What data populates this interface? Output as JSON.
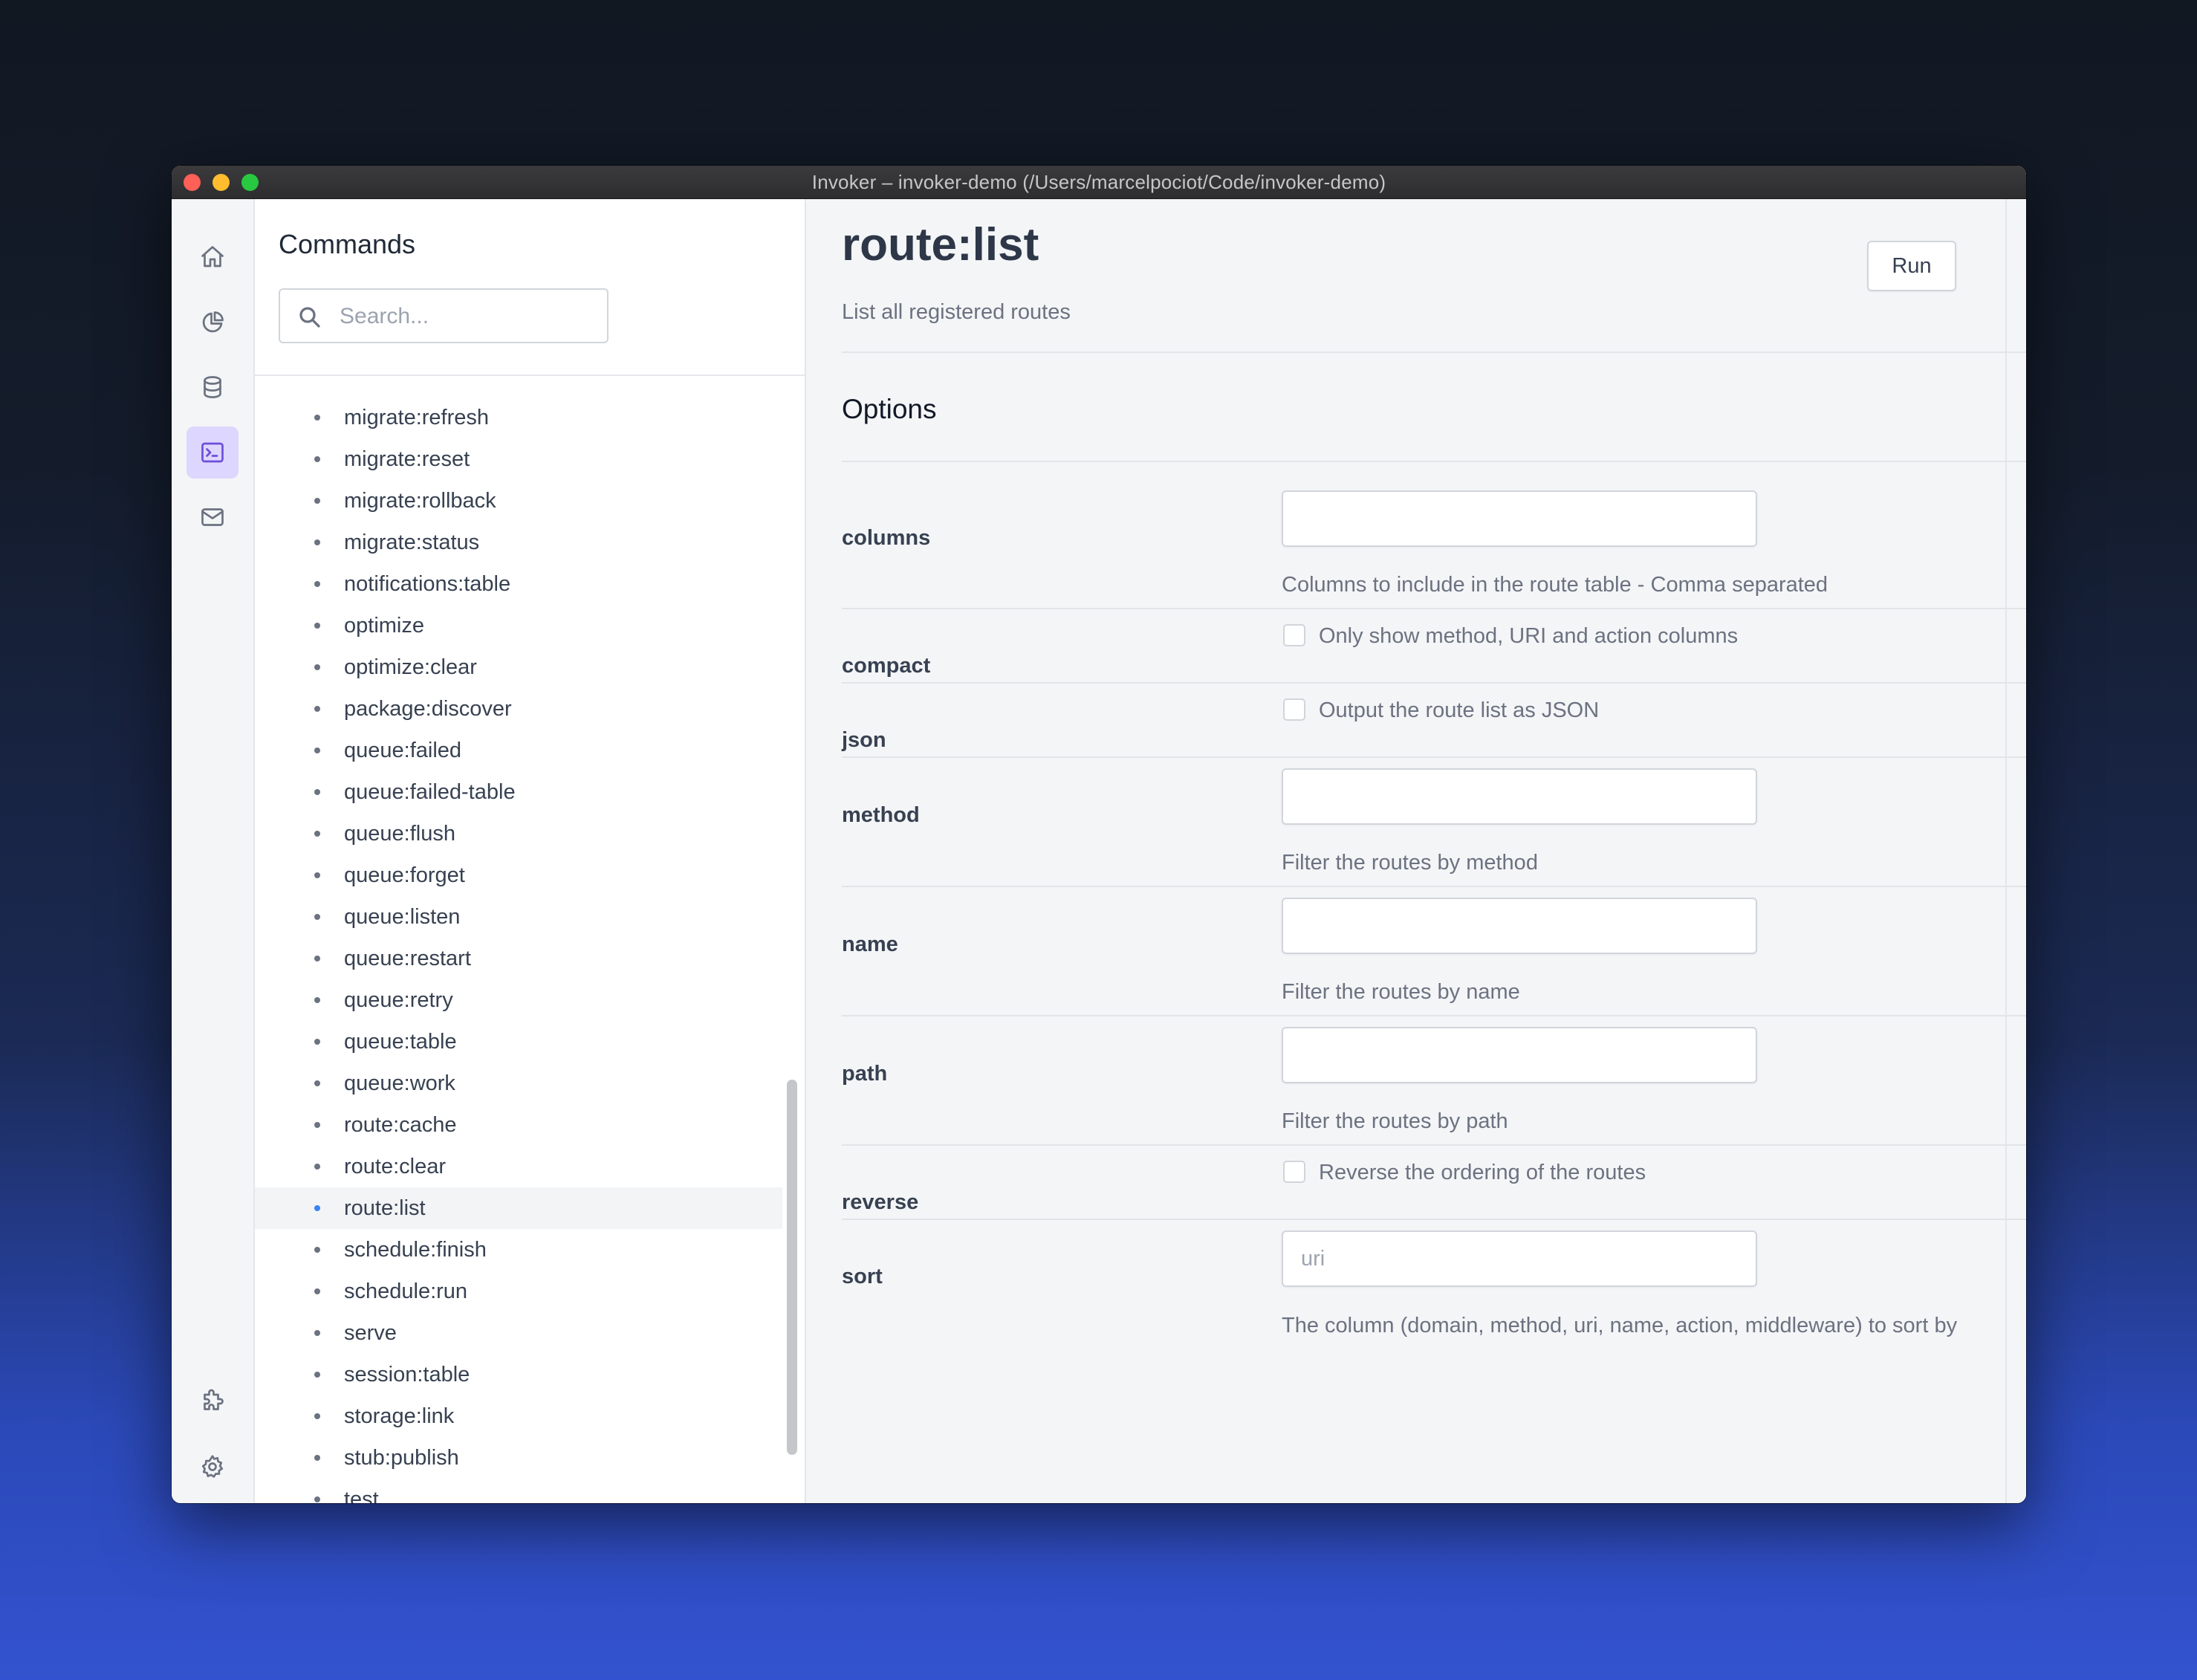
{
  "window": {
    "title": "Invoker – invoker-demo (/Users/marcelpociot/Code/invoker-demo)"
  },
  "rail": {
    "items": [
      {
        "icon": "home-icon",
        "active": false
      },
      {
        "icon": "pie-chart-icon",
        "active": false
      },
      {
        "icon": "database-icon",
        "active": false
      },
      {
        "icon": "terminal-icon",
        "active": true
      },
      {
        "icon": "mail-icon",
        "active": false
      },
      {
        "icon": "puzzle-icon",
        "active": false
      },
      {
        "icon": "gear-icon",
        "active": false
      }
    ]
  },
  "commands": {
    "heading": "Commands",
    "search_placeholder": "Search...",
    "items": [
      "migrate:refresh",
      "migrate:reset",
      "migrate:rollback",
      "migrate:status",
      "notifications:table",
      "optimize",
      "optimize:clear",
      "package:discover",
      "queue:failed",
      "queue:failed-table",
      "queue:flush",
      "queue:forget",
      "queue:listen",
      "queue:restart",
      "queue:retry",
      "queue:table",
      "queue:work",
      "route:cache",
      "route:clear",
      "route:list",
      "schedule:finish",
      "schedule:run",
      "serve",
      "session:table",
      "storage:link",
      "stub:publish",
      "test"
    ],
    "active_item": "route:list",
    "accent_color": "#3b82f6"
  },
  "command": {
    "name": "route:list",
    "description": "List all registered routes",
    "run_label": "Run"
  },
  "options": {
    "heading": "Options",
    "columns": {
      "name": "columns",
      "value": "",
      "placeholder": "",
      "help": "Columns to include in the route table - Comma separated"
    },
    "compact": {
      "name": "compact",
      "checked": false,
      "label": "Only show method, URI and action columns"
    },
    "json": {
      "name": "json",
      "checked": false,
      "label": "Output the route list as JSON"
    },
    "method": {
      "name": "method",
      "value": "",
      "placeholder": "",
      "help": "Filter the routes by method"
    },
    "name": {
      "name": "name",
      "value": "",
      "placeholder": "",
      "help": "Filter the routes by name"
    },
    "path": {
      "name": "path",
      "value": "",
      "placeholder": "",
      "help": "Filter the routes by path"
    },
    "reverse": {
      "name": "reverse",
      "checked": false,
      "label": "Reverse the ordering of the routes"
    },
    "sort": {
      "name": "sort",
      "value": "",
      "placeholder": "uri",
      "help": "The column (domain, method, uri, name, action, middleware) to sort by"
    }
  }
}
